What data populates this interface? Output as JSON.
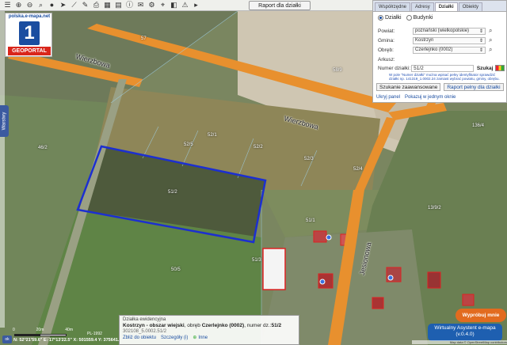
{
  "toolbar": {
    "icons": [
      "layers-icon",
      "zoom-in-icon",
      "zoom-out-icon",
      "search-icon",
      "circle-icon",
      "pointer-icon",
      "measure-icon",
      "pencil-icon",
      "print-icon",
      "table-icon",
      "grid-icon",
      "info-icon",
      "chat-icon",
      "settings-icon",
      "location-icon",
      "cube-icon",
      "warning-icon",
      "more-icon"
    ],
    "report_label": "Raport dla działki"
  },
  "logo": {
    "site": "polska.e-mapa.net",
    "number": "1",
    "name": "GEOPORTAL"
  },
  "left_tab": {
    "label": "Warstwy"
  },
  "panel": {
    "tabs": [
      {
        "label": "Współrzędne",
        "active": false
      },
      {
        "label": "Adresy",
        "active": false
      },
      {
        "label": "Działki",
        "active": true
      },
      {
        "label": "Obiekty",
        "active": false
      }
    ],
    "radio_dzialki": "Działki",
    "radio_budynki": "Budynki",
    "fields": [
      {
        "label": "Powiat:",
        "value": "poznański (wielkopolskie)"
      },
      {
        "label": "Gmina:",
        "value": "Kostrzyn"
      },
      {
        "label": "Obręb:",
        "value": "Czerlejnko (0002)"
      },
      {
        "label": "Arkusz:",
        "value": ""
      }
    ],
    "numer_label": "Numer działki:",
    "numer_value": "51/2",
    "szukaj_label": "Szukaj",
    "hint": "W pole \"Numer działki\" można wpisać pełny identyfikator sprawdzić działki np. 141319_1.0002.24 zamiast wybrać powiatu, gminy, obrębu.",
    "adv_label": "Szukanie zaawansowane",
    "report_label": "Raport pełny dla działki",
    "hide_label": "Ukryj panel",
    "show_all_label": "Pokazuj w jednym oknie"
  },
  "map": {
    "streets": [
      "Wierzbowa",
      "Wierzbowa",
      "Jesionowa"
    ],
    "parcels": [
      "57",
      "58/9",
      "52/1",
      "52/2",
      "52/3",
      "52/4",
      "52/5",
      "51/2",
      "46/2",
      "51/1",
      "51/3",
      "50/5",
      "136/4",
      "13/9/2"
    ]
  },
  "info": {
    "title": "Działka ewidencyjna",
    "main_bold": "Kostrzyn - obszar wiejski",
    "main_mid": ", obręb ",
    "obreb": "Czerlejnko (0002)",
    "main_num": ", numer dz.:",
    "numer": "51/2",
    "id": "302108_5.0002.51/2",
    "link_zoom": "Zbliż do obiektu",
    "link_details": "Szczegóły (i)",
    "link_other": "Inne"
  },
  "scale": {
    "labels": [
      "0",
      "20m",
      "40m"
    ],
    "pl": "PL-1992"
  },
  "coords": "N: 52°21'59.6\"  E: 17°13'22.5\"  X: 501559.4  Y: 375641.",
  "ok_label": "ok",
  "try_label": "Wypróbuj mnie",
  "assistant": {
    "line1": "Wirtualny Asystent e-mapa",
    "line2": "(v.0.4.0)"
  },
  "attribution": "Map data © OpenStreetMap contributors",
  "colors": {
    "parcel": "#1c2fd0",
    "road": "#e8902e",
    "brand": "#1a4da0",
    "accent": "#e26b1f"
  }
}
